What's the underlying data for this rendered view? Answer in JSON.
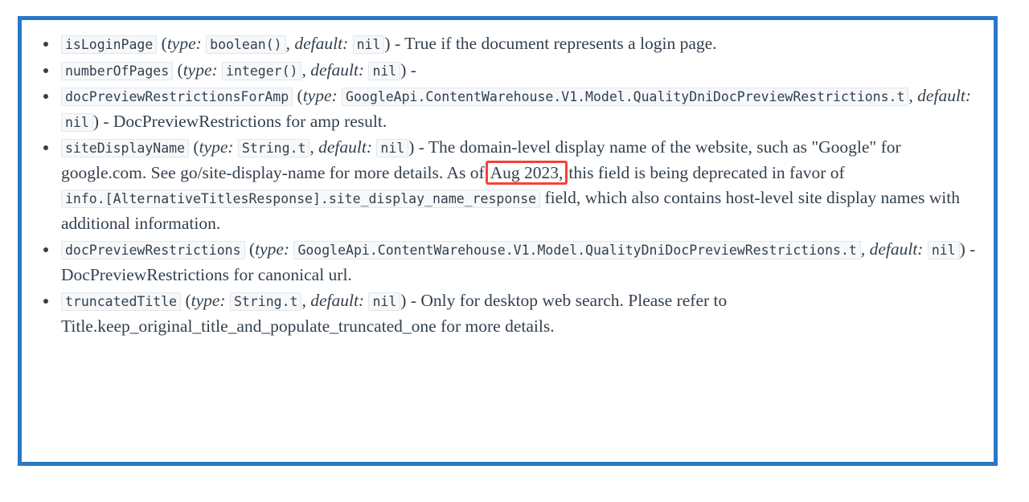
{
  "document": {
    "border_color": "#2878c8",
    "highlight_color": "#f44336",
    "text_color": "#33404d",
    "code_bg": "#f6f8fa"
  },
  "fields": [
    {
      "name": "isLoginPage",
      "type_label": "type:",
      "type_value": "boolean()",
      "default_label": "default:",
      "default_value": "nil",
      "dash": "-",
      "description": "True if the document represents a login page."
    },
    {
      "name": "numberOfPages",
      "type_label": "type:",
      "type_value": "integer()",
      "default_label": "default:",
      "default_value": "nil",
      "dash": "-",
      "description": ""
    },
    {
      "name": "docPreviewRestrictionsForAmp",
      "type_label": "type:",
      "type_value": "GoogleApi.ContentWarehouse.V1.Model.QualityDniDocPreviewRestrictions.t",
      "default_label": "default:",
      "default_value": "nil",
      "dash": "-",
      "description": "DocPreviewRestrictions for amp result."
    },
    {
      "name": "siteDisplayName",
      "type_label": "type:",
      "type_value": "String.t",
      "default_label": "default:",
      "default_value": "nil",
      "dash": "-",
      "desc_part1": "The domain-level display name of the website, such as \"Google\" for google.com. See go/site-display-name for more details. As of",
      "highlight_text": "Aug 2023,",
      "desc_part2": "this field is being deprecated in favor of",
      "inline_code": "info.[AlternativeTitlesResponse].site_display_name_response",
      "desc_part3": "field, which also contains host-level site display names with additional information."
    },
    {
      "name": "docPreviewRestrictions",
      "type_label": "type:",
      "type_value": "GoogleApi.ContentWarehouse.V1.Model.QualityDniDocPreviewRestrictions.t",
      "default_label": "default:",
      "default_value": "nil",
      "dash": "-",
      "description": "DocPreviewRestrictions for canonical url."
    },
    {
      "name": "truncatedTitle",
      "type_label": "type:",
      "type_value": "String.t",
      "default_label": "default:",
      "default_value": "nil",
      "dash": "-",
      "description": "Only for desktop web search. Please refer to Title.keep_original_title_and_populate_truncated_one for more details."
    }
  ],
  "punctuation": {
    "open_paren": "(",
    "close_paren": ")",
    "comma": ","
  }
}
